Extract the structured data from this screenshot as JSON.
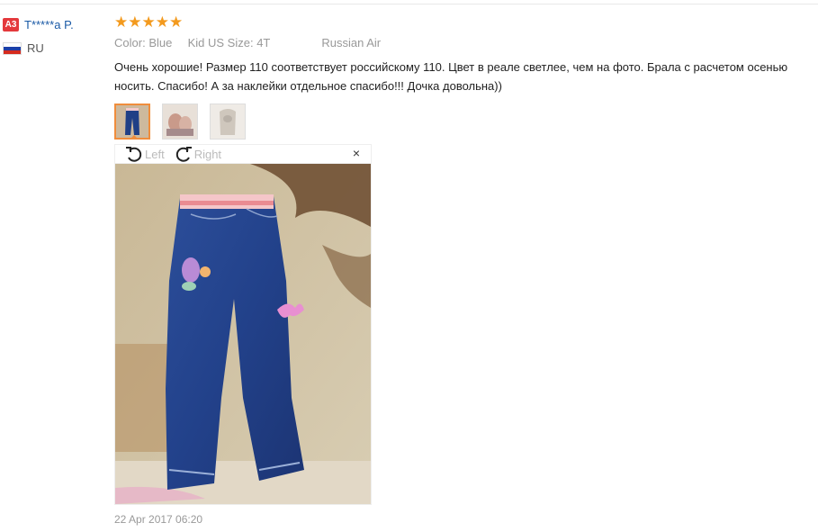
{
  "user": {
    "level_badge": "A3",
    "name": "T*****a P.",
    "country": "RU"
  },
  "review": {
    "rating": 5,
    "stars": [
      "★",
      "★",
      "★",
      "★",
      "★"
    ],
    "color_label": "Color:",
    "color_value": "Blue",
    "size_label": "Kid US Size:",
    "size_value": "4T",
    "shipping": "Russian Air",
    "text": "Очень хорошие! Размер 110 соответствует российскому 110. Цвет в реале светлее, чем на фото. Брала с расчетом осенью носить. Спасибо! А за наклейки отдельное спасибо!!! Дочка довольна))",
    "date": "22 Apr 2017 06:20"
  },
  "viewer": {
    "rotate_left_label": "Left",
    "rotate_right_label": "Right",
    "close_label": "×"
  },
  "colors": {
    "badge": "#e4393c",
    "username": "#1a5aa6",
    "star": "#f39a1e",
    "active_thumb": "#f08d3c"
  }
}
